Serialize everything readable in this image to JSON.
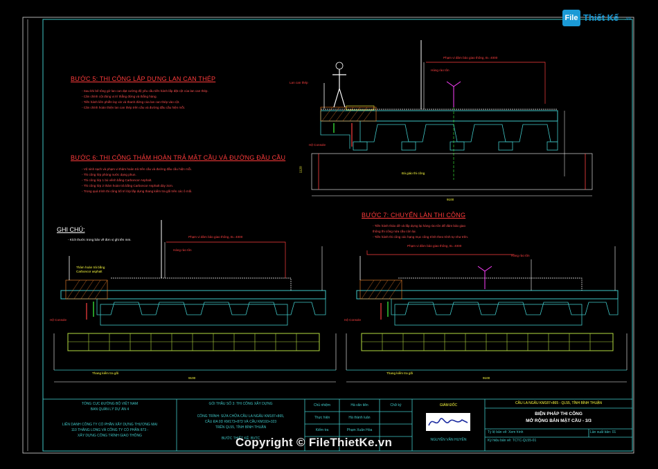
{
  "logo": {
    "badge": "File",
    "name": "Thiết Kế",
    "domain": ".vn"
  },
  "steps": {
    "step5_title": "BƯỚC 5: THI CÔNG LẮP DỰNG LAN CAN THÉP",
    "step5_notes": [
      "- Sau khi bê tông gờ lan can đạt cường độ yêu cầu tiến hành lắp đặt cột của lan can thép.",
      "- Căn chỉnh cột đúng vị trí thẳng đứng và thẳng hàng.",
      "- Tiến hành liên phiền lay xin và thanh đứng của lan can thép vào cột.",
      "- Căn chỉnh hoàn thiện lan can thép trên cầu và đường đầu cầu hiện mỗi."
    ],
    "step6_title": "BƯỚC 6: THI CÔNG THẢM HOÀN TRẢ MẶT CẦU VÀ ĐƯỜNG ĐẦU CẦU",
    "step6_notes": [
      "- Vệ sinh sạch và phạm vi thảm hoàn trả trên cầu và đường đầu cầu hiện mỗi.",
      "- Thi công lớp phòng nước dạng phun.",
      "- Thi công lớp 1 bù vênh bằng Carboncor Asphalt.",
      "- Thi công lớp 2 thảm hoàn trả bằng Carboncor Asphalt dày 3cm.",
      "- Trong quá trình thi công bố trí lớp lắp dựng thang kiểm tra gối trên các ô mối."
    ],
    "step7_title": "BƯỚC 7: CHUYỂN LÀN THI CÔNG",
    "step7_notes": [
      "- Tiến hành tháo dỡ và lắp dựng lại hàng rào tôn để đảm bảo giao",
      "  thông thi công nửa cầu còn lại.",
      "- Tiến hành thi công các hạng mục công trình theo trình tự như trên."
    ],
    "note_title": "GHI CHÚ:",
    "note_text": "- Kích thước trong bản vẽ đơn vị ghi tên mm."
  },
  "annotations": {
    "traffic_range": "Phạm vi đảm bảo giao thông, B= 4000",
    "fence": "Hàng rào tôn",
    "railing": "Lan can thép",
    "console": "Hệ Console",
    "scaffold": "Đà giáo thi công",
    "asphalt": "Thảm hoàn trả bằng\nCarboncor asphalt",
    "ladder": "Thang kiểm tra gối",
    "dim_9100": "9100",
    "dim_1120": "1120"
  },
  "title_block": {
    "org_line1": "TỔNG CỤC ĐƯỜNG BỘ VIỆT NAM",
    "org_line2": "BAN QUẢN LÝ DỰ ÁN 4",
    "contractor1": "LIÊN DANH CÔNG TY CỔ PHẦN XÂY DỰNG THƯƠNG MẠI",
    "contractor2": "110 THĂNG LONG VÀ CÔNG TY CỔ PHẦN 873 -",
    "contractor3": "XÂY DỰNG CÔNG TRÌNH GIAO THÔNG",
    "package": "GÓI THẦU SỐ 3: THI CÔNG XÂY DỰNG",
    "project1": "CÔNG TRÌNH: SỬA CHỮA CẦU LA NGÂU KM187+865,",
    "project2": "CẦU ĐA 0D KM173+873 VÀ CẦU KM193+323",
    "project3": "TRÊN QL55, TỈNH BÌNH THUẬN",
    "project4": "BƯỚC THIẾT KẾ: BVTC",
    "roles": [
      "Chủ nhiệm",
      "Thực hiện",
      "Kiểm tra"
    ],
    "names": [
      "Hà văn tiên",
      "Hà thành luân",
      "Phạm Xuân Hòa"
    ],
    "sign_col": "Chữ ký",
    "director_title": "GIÁM ĐỐC",
    "director_name": "NGUYỄN VĂN HUYÊN",
    "bridge": "CẦU LA NGÂU KM187+865 - QL55, TỈNH BÌNH THUẬN",
    "drawing_title1": "BIỆN PHÁP THI CÔNG",
    "drawing_title2": "MỞ RỘNG BẢN MẶT CẦU - 3/3",
    "scale": "Tỷ lệ bản vẽ: Xem hình",
    "sheet_no": "Ký hiệu bản vẽ: TCTC-QL55-01",
    "revision": "Lần xuất bản: 01"
  },
  "watermark": "Copyright © FileThietKe.vn"
}
